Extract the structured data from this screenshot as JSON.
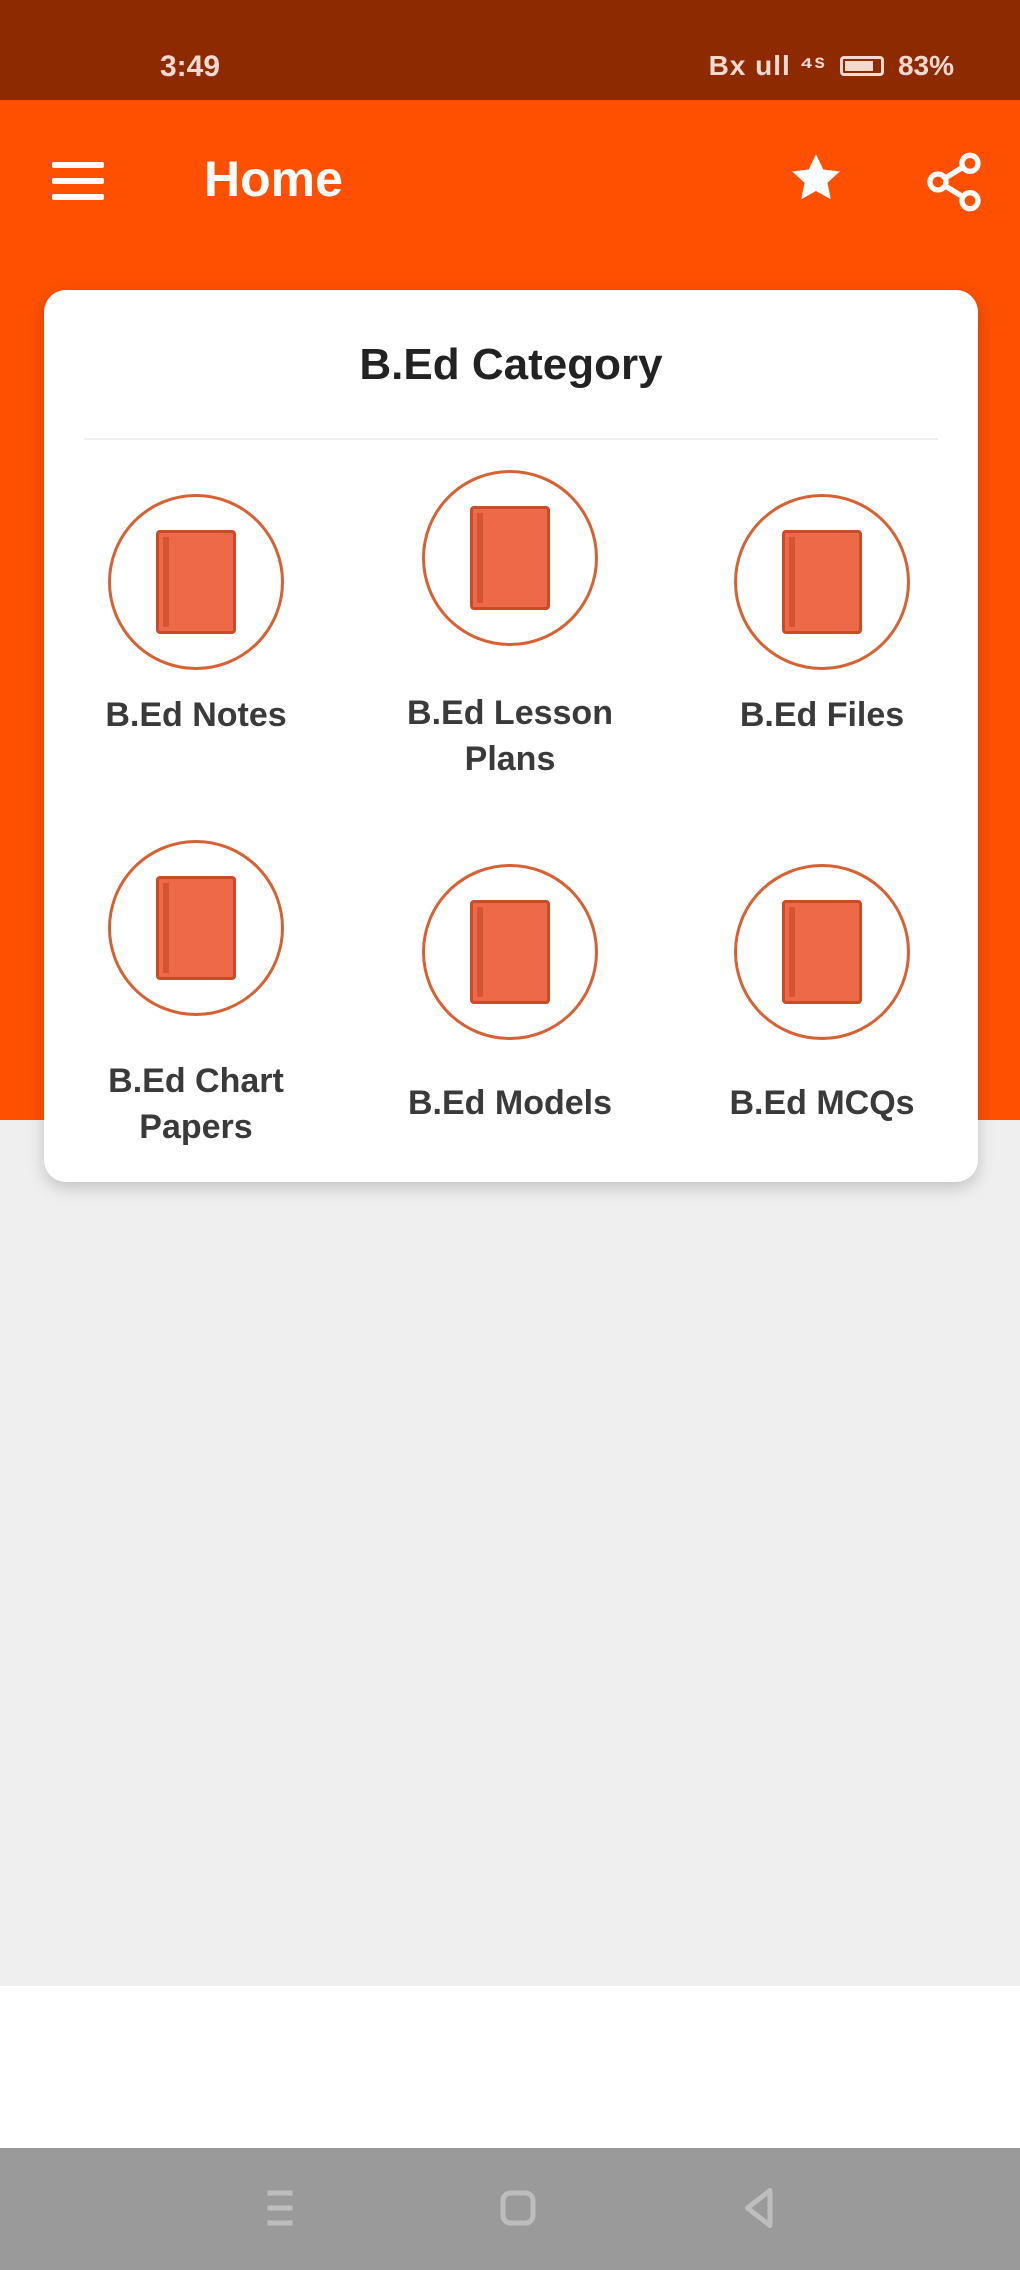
{
  "status_bar": {
    "time": "3:49",
    "signal": "Bx ull ⁴ˢ",
    "battery": "83%"
  },
  "app_bar": {
    "title": "Home"
  },
  "category": {
    "title": "B.Ed Category",
    "items": [
      {
        "label": "B.Ed Notes",
        "icon": "book-icon"
      },
      {
        "label": "B.Ed Lesson Plans",
        "icon": "book-icon"
      },
      {
        "label": "B.Ed Files",
        "icon": "book-icon"
      },
      {
        "label": "B.Ed Chart Papers",
        "icon": "book-icon"
      },
      {
        "label": "B.Ed Models",
        "icon": "book-icon"
      },
      {
        "label": "B.Ed MCQs",
        "icon": "book-icon"
      }
    ]
  },
  "colors": {
    "status_bar": "#8e2a02",
    "app_bar": "#fe5000",
    "accent": "#ee6948",
    "background": "#efefef"
  }
}
